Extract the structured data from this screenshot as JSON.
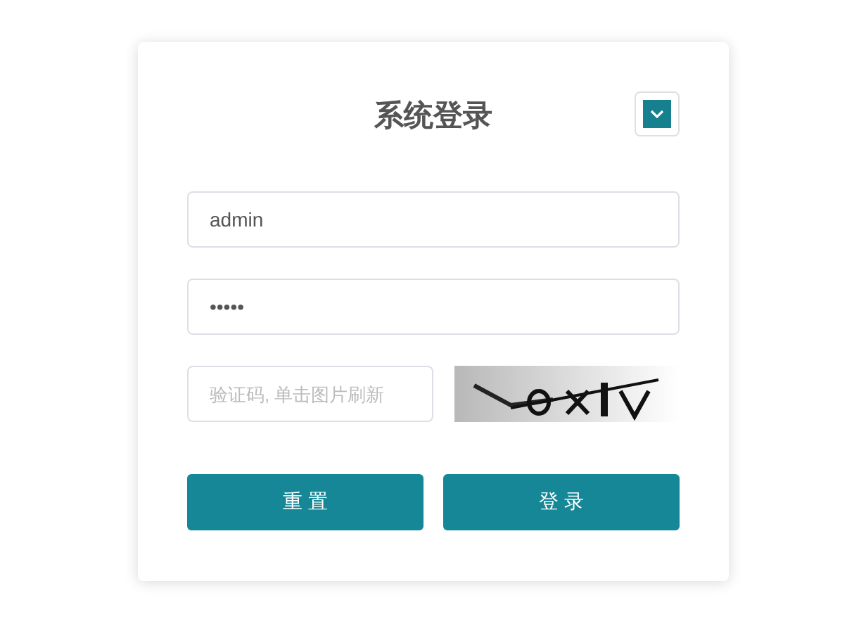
{
  "title": "系统登录",
  "fields": [
    {
      "kind": "text",
      "value": "admin"
    },
    {
      "kind": "text",
      "value": "•••••"
    }
  ],
  "captcha": {
    "placeholder": "验证码, 单击图片刷新"
  },
  "buttons": [
    {
      "label": "重 置"
    },
    {
      "label": "登 录"
    }
  ]
}
